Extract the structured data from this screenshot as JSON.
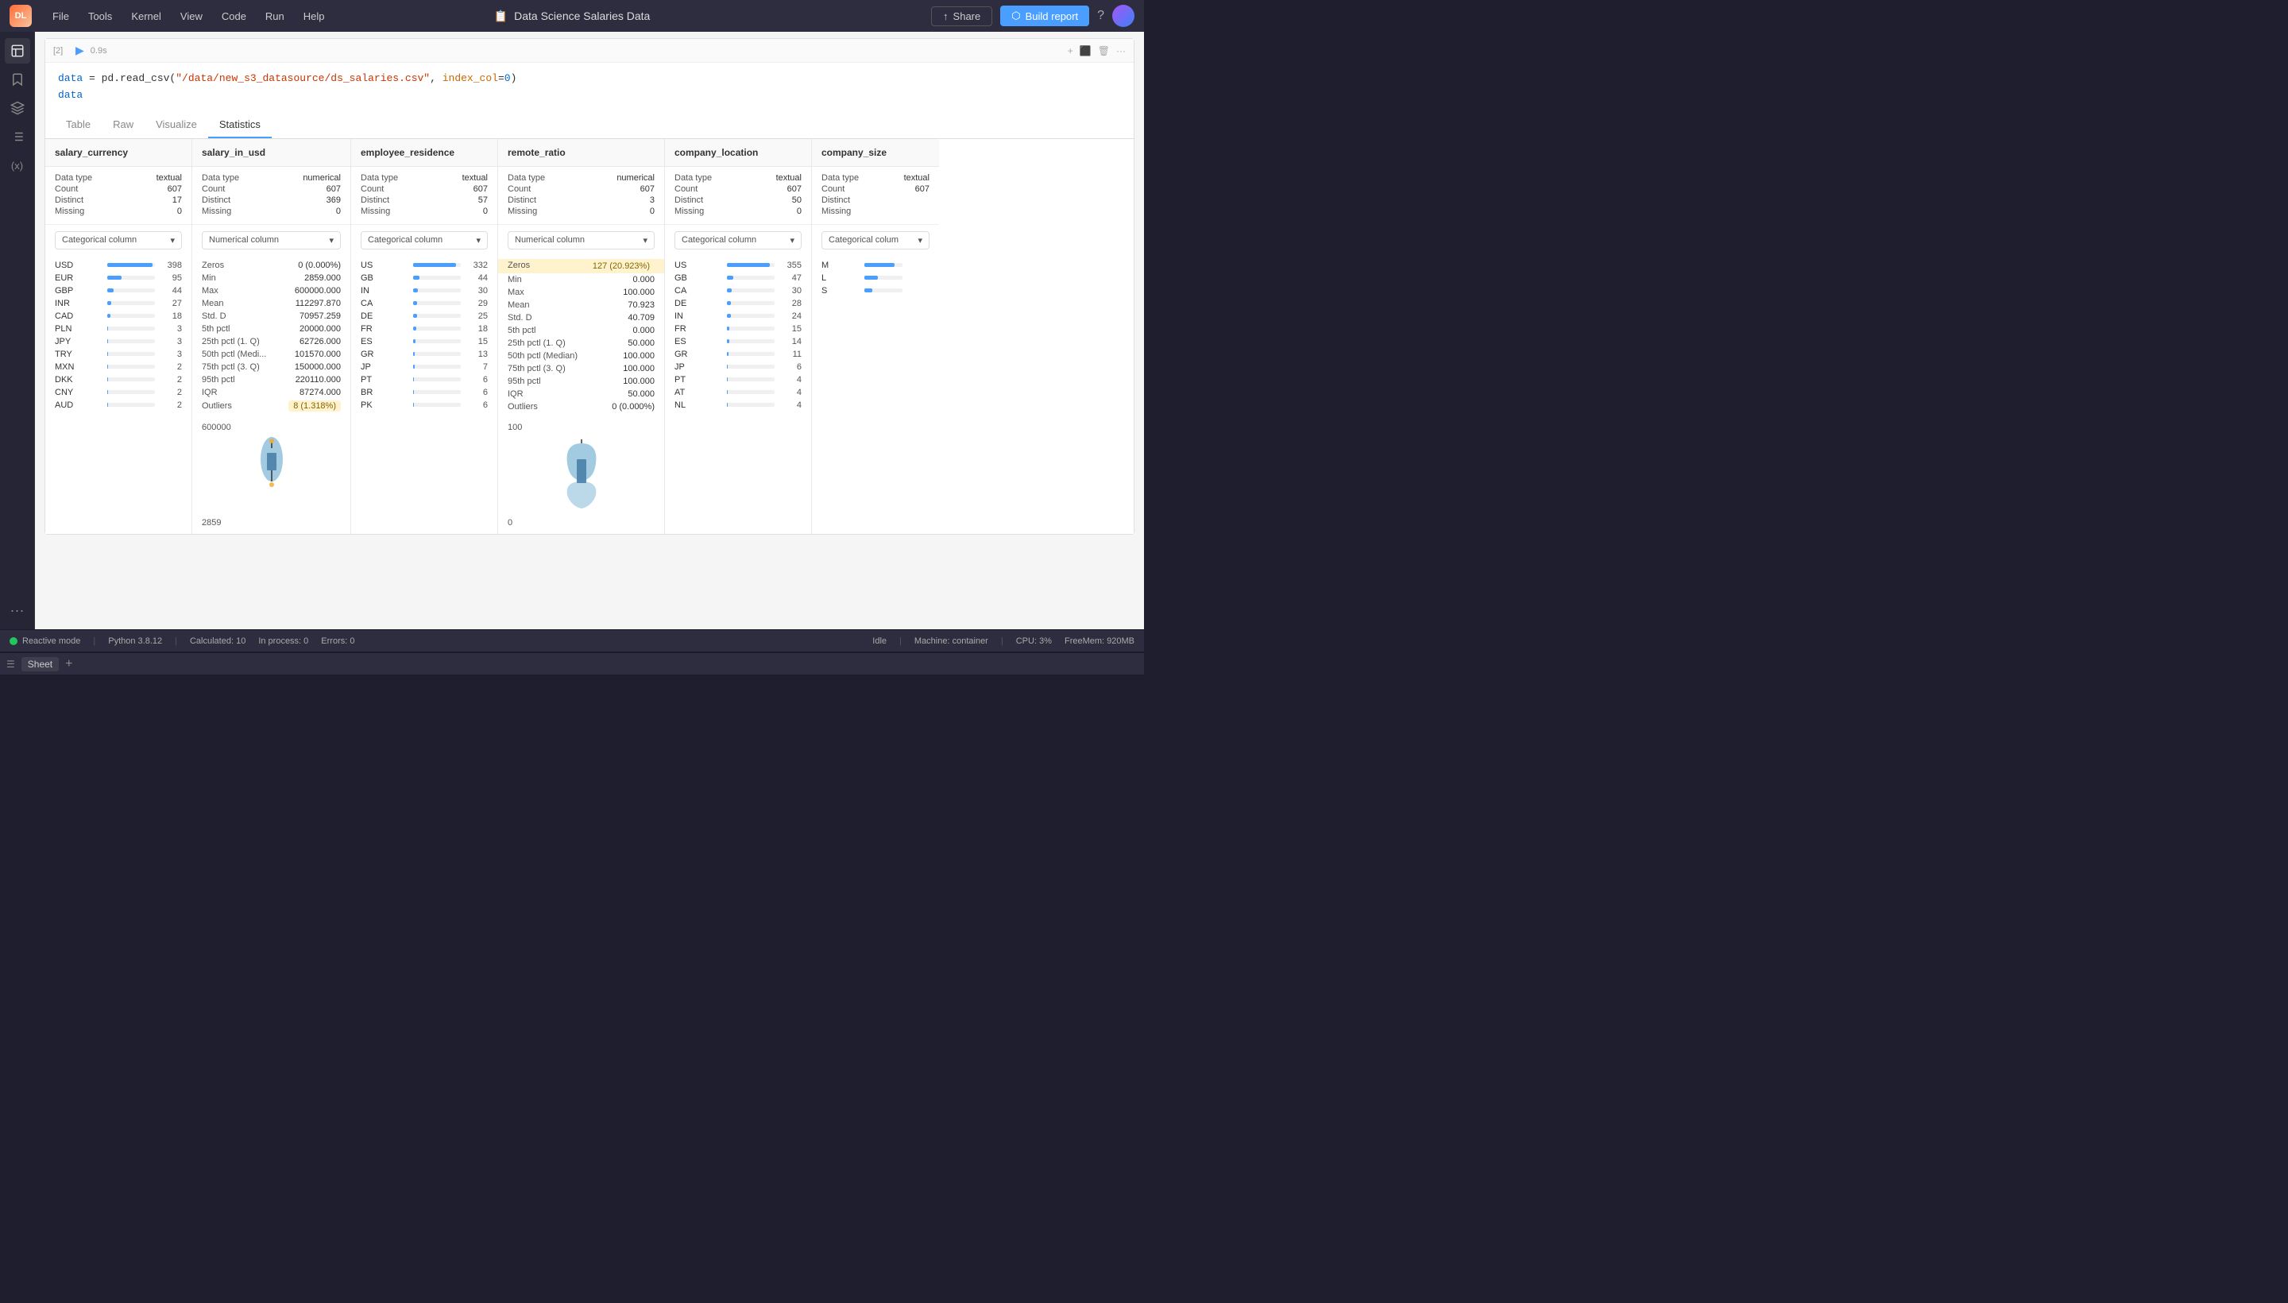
{
  "menubar": {
    "logo": "DL",
    "items": [
      "File",
      "Tools",
      "Kernel",
      "View",
      "Code",
      "Run",
      "Help"
    ],
    "title": "Data Science Salaries Data",
    "title_icon": "📄",
    "share_label": "Share",
    "build_label": "Build report",
    "help_icon": "?"
  },
  "cell": {
    "number": "[2]",
    "exec_time": "0.9s",
    "code_line1": "data = pd.read_csv(\"/data/new_s3_datasource/ds_salaries.csv\", index_col=0)",
    "code_line2": "data"
  },
  "tabs": {
    "items": [
      "Table",
      "Raw",
      "Visualize",
      "Statistics"
    ],
    "active": "Statistics"
  },
  "columns": [
    {
      "name": "salary_currency",
      "data_type": "textual",
      "count": 607,
      "distinct": 17,
      "missing": 0,
      "type_label": "Categorical column",
      "values": [
        {
          "label": "USD",
          "count": 398,
          "bar_pct": 95
        },
        {
          "label": "EUR",
          "count": 95,
          "bar_pct": 30
        },
        {
          "label": "GBP",
          "count": 44,
          "bar_pct": 14
        },
        {
          "label": "INR",
          "count": 27,
          "bar_pct": 9
        },
        {
          "label": "CAD",
          "count": 18,
          "bar_pct": 6
        },
        {
          "label": "PLN",
          "count": 3,
          "bar_pct": 2
        },
        {
          "label": "JPY",
          "count": 3,
          "bar_pct": 2
        },
        {
          "label": "TRY",
          "count": 3,
          "bar_pct": 2
        },
        {
          "label": "MXN",
          "count": 2,
          "bar_pct": 1
        },
        {
          "label": "DKK",
          "count": 2,
          "bar_pct": 1
        },
        {
          "label": "CNY",
          "count": 2,
          "bar_pct": 1
        },
        {
          "label": "AUD",
          "count": 2,
          "bar_pct": 1
        }
      ]
    },
    {
      "name": "salary_in_usd",
      "data_type": "numerical",
      "count": 607,
      "distinct": 369,
      "missing": 0,
      "type_label": "Numerical column",
      "stats": [
        {
          "label": "Zeros",
          "value": "0 (0.000%)"
        },
        {
          "label": "Min",
          "value": "2859.000"
        },
        {
          "label": "Max",
          "value": "600000.000"
        },
        {
          "label": "Mean",
          "value": "112297.870"
        },
        {
          "label": "Std. D",
          "value": "70957.259"
        },
        {
          "label": "5th pctl",
          "value": "20000.000"
        },
        {
          "label": "25th pctl (1. Q)",
          "value": "62726.000"
        },
        {
          "label": "50th pctl (Medi...",
          "value": "101570.000"
        },
        {
          "label": "75th pctl (3. Q)",
          "value": "150000.000"
        },
        {
          "label": "95th pctl",
          "value": "220110.000"
        },
        {
          "label": "IQR",
          "value": "87274.000"
        },
        {
          "label": "Outliers",
          "value": "8 (1.318%)",
          "highlight": true
        }
      ],
      "violin_top": "600000",
      "violin_bottom": "2859"
    },
    {
      "name": "employee_residence",
      "data_type": "textual",
      "count": 607,
      "distinct": 57,
      "missing": 0,
      "type_label": "Categorical column",
      "values": [
        {
          "label": "US",
          "count": 332,
          "bar_pct": 90
        },
        {
          "label": "GB",
          "count": 44,
          "bar_pct": 14
        },
        {
          "label": "IN",
          "count": 30,
          "bar_pct": 10
        },
        {
          "label": "CA",
          "count": 29,
          "bar_pct": 9
        },
        {
          "label": "DE",
          "count": 25,
          "bar_pct": 8
        },
        {
          "label": "FR",
          "count": 18,
          "bar_pct": 6
        },
        {
          "label": "ES",
          "count": 15,
          "bar_pct": 5
        },
        {
          "label": "GR",
          "count": 13,
          "bar_pct": 4
        },
        {
          "label": "JP",
          "count": 7,
          "bar_pct": 3
        },
        {
          "label": "PT",
          "count": 6,
          "bar_pct": 2
        },
        {
          "label": "BR",
          "count": 6,
          "bar_pct": 2
        },
        {
          "label": "PK",
          "count": 6,
          "bar_pct": 2
        }
      ]
    },
    {
      "name": "remote_ratio",
      "data_type": "numerical",
      "count": 607,
      "distinct": 3,
      "missing": 0,
      "type_label": "Numerical column",
      "stats": [
        {
          "label": "Zeros",
          "value": "127 (20.923%)",
          "highlight": true
        },
        {
          "label": "Min",
          "value": "0.000"
        },
        {
          "label": "Max",
          "value": "100.000"
        },
        {
          "label": "Mean",
          "value": "70.923"
        },
        {
          "label": "Std. D",
          "value": "40.709"
        },
        {
          "label": "5th pctl",
          "value": "0.000"
        },
        {
          "label": "25th pctl (1. Q)",
          "value": "50.000"
        },
        {
          "label": "50th pctl (Median)",
          "value": "100.000"
        },
        {
          "label": "75th pctl (3. Q)",
          "value": "100.000"
        },
        {
          "label": "95th pctl",
          "value": "100.000"
        },
        {
          "label": "IQR",
          "value": "50.000"
        },
        {
          "label": "Outliers",
          "value": "0 (0.000%)"
        }
      ],
      "violin_top": "100",
      "violin_bottom": "0"
    },
    {
      "name": "company_location",
      "data_type": "textual",
      "count": 607,
      "distinct": 50,
      "missing": 0,
      "type_label": "Categorical column",
      "values": [
        {
          "label": "US",
          "count": 355,
          "bar_pct": 90
        },
        {
          "label": "GB",
          "count": 47,
          "bar_pct": 14
        },
        {
          "label": "CA",
          "count": 30,
          "bar_pct": 10
        },
        {
          "label": "DE",
          "count": 28,
          "bar_pct": 9
        },
        {
          "label": "IN",
          "count": 24,
          "bar_pct": 8
        },
        {
          "label": "FR",
          "count": 15,
          "bar_pct": 5
        },
        {
          "label": "ES",
          "count": 14,
          "bar_pct": 5
        },
        {
          "label": "GR",
          "count": 11,
          "bar_pct": 4
        },
        {
          "label": "JP",
          "count": 6,
          "bar_pct": 2
        },
        {
          "label": "PT",
          "count": 4,
          "bar_pct": 2
        },
        {
          "label": "AT",
          "count": 4,
          "bar_pct": 2
        },
        {
          "label": "NL",
          "count": 4,
          "bar_pct": 2
        }
      ]
    },
    {
      "name": "company_size",
      "data_type": "textual",
      "count": 607,
      "distinct": "",
      "missing": "",
      "type_label": "Categorical column",
      "values": [
        {
          "label": "M",
          "count": "",
          "bar_pct": 80
        },
        {
          "label": "L",
          "count": "",
          "bar_pct": 35
        },
        {
          "label": "S",
          "count": "",
          "bar_pct": 20
        }
      ]
    }
  ],
  "statusbar": {
    "reactive_mode": "Reactive mode",
    "python_version": "Python 3.8.12",
    "calculated": "Calculated: 10",
    "in_process": "In process: 0",
    "errors": "Errors: 0",
    "idle": "Idle",
    "machine": "Machine: container",
    "cpu": "CPU:  3%",
    "freemem": "FreeMem:  920MB"
  },
  "sidebar": {
    "icons": [
      "pages",
      "bookmark",
      "layers",
      "list",
      "variable"
    ]
  }
}
